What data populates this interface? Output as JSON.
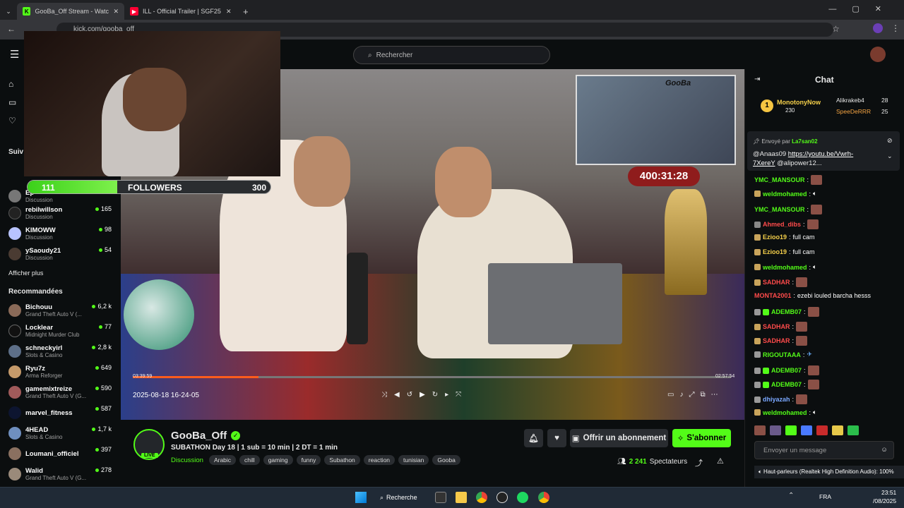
{
  "browser": {
    "tabs": [
      {
        "label": "GooBa_Off Stream - Watch",
        "icon": "kick-favicon",
        "color": "#53fc18"
      },
      {
        "label": "ILL - Official Trailer | SGF25 - Yo",
        "icon": "youtube-favicon",
        "color": "#ff0033"
      }
    ],
    "url": "kick.com/gooba_off"
  },
  "header": {
    "search_placeholder": "Rechercher"
  },
  "sidebar": {
    "following_title": "Suiv",
    "following": [
      {
        "name": "",
        "game": "Discussion",
        "count": ""
      },
      {
        "name": "Ep",
        "game": "Discussion",
        "count": ""
      },
      {
        "name": "rebilwillson",
        "game": "Discussion",
        "count": "165"
      },
      {
        "name": "KIMOWW",
        "game": "Discussion",
        "count": "98"
      },
      {
        "name": "ySaoudy21",
        "game": "Discussion",
        "count": "54"
      }
    ],
    "show_more": "Afficher plus",
    "recommended_title": "Recommandées",
    "recommended": [
      {
        "name": "Bichouu",
        "game": "Grand Theft Auto V (...",
        "count": "6,2 k"
      },
      {
        "name": "Locklear",
        "game": "Midnight Murder Club",
        "count": "77"
      },
      {
        "name": "schneckyirl",
        "game": "Slots & Casino",
        "count": "2,8 k"
      },
      {
        "name": "Ryu7z",
        "game": "Arma Reforger",
        "count": "649"
      },
      {
        "name": "gamemixtreize",
        "game": "Grand Theft Auto V (G...",
        "count": "590"
      },
      {
        "name": "marvel_fitness",
        "game": "",
        "count": "587"
      },
      {
        "name": "4HEAD",
        "game": "Slots & Casino",
        "count": "1,7 k"
      },
      {
        "name": "Loumani_officiel",
        "game": "",
        "count": "397"
      },
      {
        "name": "Walid",
        "game": "Grand Theft Auto V (G...",
        "count": "278"
      }
    ]
  },
  "video": {
    "follower_goal": {
      "current": "111",
      "label": "FOLLOWERS",
      "target": "300",
      "progress": 0.37
    },
    "timer": "400:31:28",
    "pip_brand": "GooBa",
    "date_overlay": "2025-08-18 16-24-05",
    "elapsed": "03:39:59",
    "duration": "02:57:54",
    "progress": 0.21
  },
  "stream": {
    "channel": "GooBa_Off",
    "live_badge": "LIVE",
    "title": "SUBATHON Day 18 | 1 sub = 10 min | 2 DT = 1 min",
    "category": "Discussion",
    "tags": [
      "Arabic",
      "chill",
      "gaming",
      "funny",
      "Subathon",
      "reaction",
      "tunisian",
      "Gooba"
    ],
    "subscribe_gift": "Offrir un abonnement",
    "subscribe": "S'abonner",
    "viewers": "2 241",
    "viewers_label": "Spectateurs"
  },
  "chat": {
    "title": "Chat",
    "leaderboard": [
      {
        "rank": "1",
        "name": "MonotonyNow",
        "value": "230"
      },
      {
        "name": "Alikrakeb4",
        "value": "28"
      },
      {
        "name": "SpeeDeRRR",
        "value": "25"
      }
    ],
    "pinned": {
      "sent_by": "Envoyé par",
      "author": "La7san02",
      "mention": "@Anaas09",
      "link": "https://youtu.be/Vwrh-7XereY",
      "rest": "@alipower12..."
    },
    "messages": [
      {
        "user": "YMC_MANSOUR",
        "color": "green",
        "text": ""
      },
      {
        "user": "weldmohamed",
        "color": "green",
        "text": ""
      },
      {
        "user": "YMC_MANSOUR",
        "color": "green",
        "text": ""
      },
      {
        "user": "Ahmed_dibs",
        "color": "red",
        "text": ""
      },
      {
        "user": "Ezioo19",
        "color": "yellow",
        "text": "full cam"
      },
      {
        "user": "Ezioo19",
        "color": "yellow",
        "text": "full cam"
      },
      {
        "user": "weldmohamed",
        "color": "green",
        "text": ""
      },
      {
        "user": "SADHAR",
        "color": "red",
        "text": ""
      },
      {
        "user": "MONTA2001",
        "color": "red",
        "text": "ezebi louled barcha hesss"
      },
      {
        "user": "ADEMB07",
        "color": "green",
        "text": ""
      },
      {
        "user": "SADHAR",
        "color": "red",
        "text": ""
      },
      {
        "user": "SADHAR",
        "color": "red",
        "text": ""
      },
      {
        "user": "RIGOUTAAA",
        "color": "green",
        "text": ""
      },
      {
        "user": "ADEMB07",
        "color": "green",
        "text": ""
      },
      {
        "user": "ADEMB07",
        "color": "green",
        "text": ""
      },
      {
        "user": "dhiyazah",
        "color": "blue",
        "text": ""
      },
      {
        "user": "weldmohamed",
        "color": "green",
        "text": ""
      }
    ],
    "input_placeholder": "Envoyer un message",
    "audio_toast": "Haut-parleurs (Realtek High Definition Audio): 100%"
  },
  "taskbar": {
    "search": "Recherche",
    "lang": "FRA",
    "time": "23:51",
    "date": "/08/2025"
  }
}
